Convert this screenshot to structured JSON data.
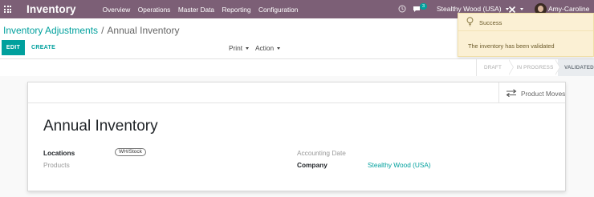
{
  "navbar": {
    "app_title": "Inventory",
    "menu": [
      "Overview",
      "Operations",
      "Master Data",
      "Reporting",
      "Configuration"
    ],
    "chat_count": "3",
    "company": "Stealthy Wood (USA)",
    "user": "Amy-Caroline",
    "bg_color": "#7c5f76"
  },
  "breadcrumb": {
    "parent": "Inventory Adjustments",
    "separator": "/",
    "current": "Annual Inventory"
  },
  "buttons": {
    "edit": "EDIT",
    "create": "CREATE",
    "print": "Print",
    "action": "Action"
  },
  "statusbar": {
    "stages": [
      "DRAFT",
      "IN PROGRESS",
      "VALIDATED"
    ],
    "active": "VALIDATED"
  },
  "notification": {
    "title": "Success",
    "message": "The inventory has been validated",
    "icon": "lightbulb-icon"
  },
  "sheet": {
    "smart_button": "Product Moves",
    "title": "Annual Inventory",
    "locations_label": "Locations",
    "locations_value": "WH/Stock",
    "products_label": "Products",
    "accounting_date_label": "Accounting Date",
    "company_label": "Company",
    "company_value": "Stealthy Wood (USA)"
  },
  "colors": {
    "accent": "#00a09d",
    "notification_bg": "#fbf0d4"
  }
}
